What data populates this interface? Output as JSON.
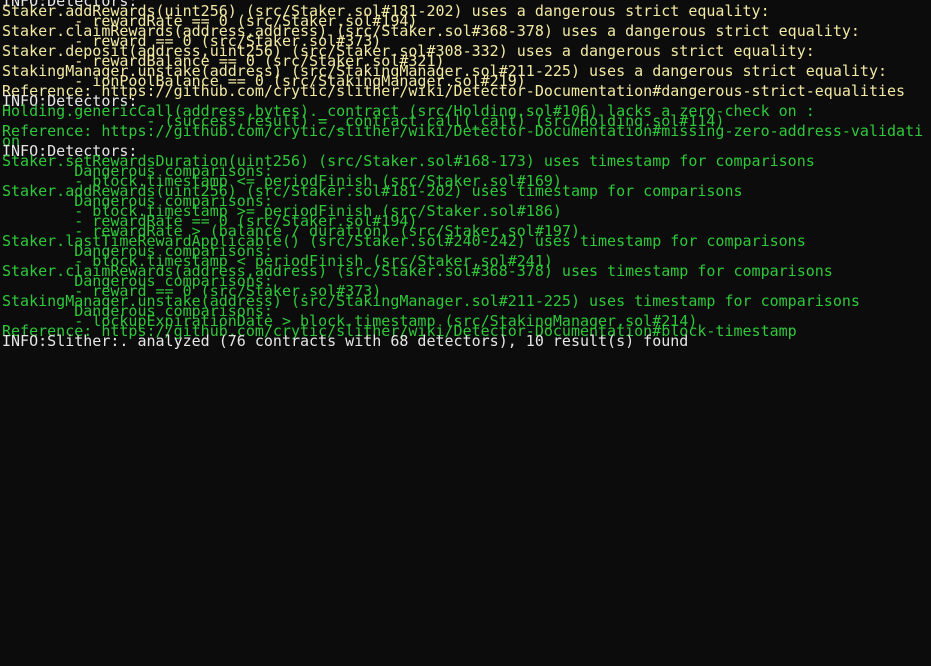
{
  "colors": {
    "background": "#0c0c0c",
    "info_text": "#e6e6e6",
    "yellow_text": "#f2e9a3",
    "green_text": "#2fc83a"
  },
  "terminal": {
    "lines": [
      {
        "style": "plain",
        "text": "INFO:Detectors:"
      },
      {
        "style": "yellow",
        "text": "Staker.addRewards(uint256) (src/Staker.sol#181-202) uses a dangerous strict equality:"
      },
      {
        "style": "yellow",
        "text": "        - rewardRate == 0 (src/Staker.sol#194)"
      },
      {
        "style": "yellow",
        "text": "Staker.claimRewards(address,address) (src/Staker.sol#368-378) uses a dangerous strict equality:"
      },
      {
        "style": "yellow",
        "text": "        - reward == 0 (src/Staker.sol#373)"
      },
      {
        "style": "yellow",
        "text": "Staker.deposit(address,uint256) (src/Staker.sol#308-332) uses a dangerous strict equality:"
      },
      {
        "style": "yellow",
        "text": "        - rewardBalance == 0 (src/Staker.sol#321)"
      },
      {
        "style": "yellow",
        "text": "StakingManager.unstake(address) (src/StakingManager.sol#211-225) uses a dangerous strict equality:"
      },
      {
        "style": "yellow",
        "text": "        - ionPoolBalance == 0 (src/StakingManager.sol#219)"
      },
      {
        "style": "yellow",
        "text": "Reference: https://github.com/crytic/slither/wiki/Detector-Documentation#dangerous-strict-equalities"
      },
      {
        "style": "plain",
        "text": "INFO:Detectors:"
      },
      {
        "style": "green",
        "text": "Holding.genericCall(address,bytes)._contract (src/Holding.sol#106) lacks a zero-check on :"
      },
      {
        "style": "green",
        "text": "                - (success,result) = _contract.call(_call) (src/Holding.sol#114)"
      },
      {
        "style": "green",
        "text": "Reference: https://github.com/crytic/slither/wiki/Detector-Documentation#missing-zero-address-validati"
      },
      {
        "style": "green",
        "text": "on"
      },
      {
        "style": "plain",
        "text": "INFO:Detectors:"
      },
      {
        "style": "green",
        "text": "Staker.setRewardsDuration(uint256) (src/Staker.sol#168-173) uses timestamp for comparisons"
      },
      {
        "style": "green",
        "text": "        Dangerous comparisons:"
      },
      {
        "style": "green",
        "text": "        - block.timestamp <= periodFinish (src/Staker.sol#169)"
      },
      {
        "style": "green",
        "text": "Staker.addRewards(uint256) (src/Staker.sol#181-202) uses timestamp for comparisons"
      },
      {
        "style": "green",
        "text": "        Dangerous comparisons:"
      },
      {
        "style": "green",
        "text": "        - block.timestamp >= periodFinish (src/Staker.sol#186)"
      },
      {
        "style": "green",
        "text": "        - rewardRate == 0 (src/Staker.sol#194)"
      },
      {
        "style": "green",
        "text": "        - rewardRate > (balance / duration) (src/Staker.sol#197)"
      },
      {
        "style": "green",
        "text": "Staker.lastTimeRewardApplicable() (src/Staker.sol#240-242) uses timestamp for comparisons"
      },
      {
        "style": "green",
        "text": "        Dangerous comparisons:"
      },
      {
        "style": "green",
        "text": "        - block.timestamp < periodFinish (src/Staker.sol#241)"
      },
      {
        "style": "green",
        "text": "Staker.claimRewards(address,address) (src/Staker.sol#368-378) uses timestamp for comparisons"
      },
      {
        "style": "green",
        "text": "        Dangerous comparisons:"
      },
      {
        "style": "green",
        "text": "        - reward == 0 (src/Staker.sol#373)"
      },
      {
        "style": "green",
        "text": "StakingManager.unstake(address) (src/StakingManager.sol#211-225) uses timestamp for comparisons"
      },
      {
        "style": "green",
        "text": "        Dangerous comparisons:"
      },
      {
        "style": "green",
        "text": "        - lockupExpirationDate > block.timestamp (src/StakingManager.sol#214)"
      },
      {
        "style": "green",
        "text": "Reference: https://github.com/crytic/slither/wiki/Detector-Documentation#block-timestamp"
      },
      {
        "style": "plain",
        "text": "INFO:Slither:. analyzed (76 contracts with 68 detectors), 10 result(s) found"
      }
    ]
  }
}
